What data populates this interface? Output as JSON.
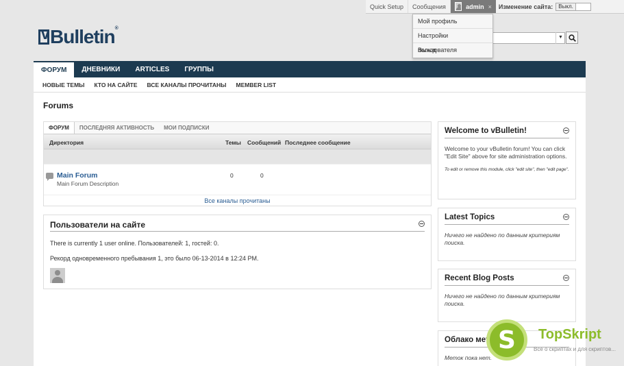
{
  "topbar": {
    "quick_setup": "Quick Setup",
    "messages": "Сообщения",
    "username": "admin",
    "close": "×",
    "edit_site_label": "Изменение сайта:",
    "toggle_value": "Выкл."
  },
  "user_menu": {
    "items": [
      "Мой профиль",
      "Настройки пользователя",
      "Выход"
    ]
  },
  "logo": {
    "text": "Bulletin",
    "tm": "®"
  },
  "search": {
    "dropdown_icon": "▼",
    "icon": "search-icon"
  },
  "nav": {
    "tabs": [
      "ФОРУМ",
      "ДНЕВНИКИ",
      "ARTICLES",
      "ГРУППЫ"
    ],
    "active_tab": 0,
    "subtabs": [
      "НОВЫЕ ТЕМЫ",
      "КТО НА САЙТЕ",
      "ВСЕ КАНАЛЫ ПРОЧИТАНЫ",
      "MEMBER LIST"
    ]
  },
  "page_title": "Forums",
  "forum_box": {
    "tabs": [
      "ФОРУМ",
      "ПОСЛЕДНЯЯ АКТИВНОСТЬ",
      "МОИ ПОДПИСКИ"
    ],
    "columns": [
      "Директория",
      "Темы",
      "Сообщений",
      "Последнее сообщение"
    ],
    "forum": {
      "name": "Main Forum",
      "description": "Main Forum Description",
      "threads": "0",
      "posts": "0"
    },
    "mark_read": "Все каналы прочитаны"
  },
  "online_box": {
    "title": "Пользователи на сайте",
    "line1": "There is currently 1 user online. Пользователей: 1, гостей: 0.",
    "line2": "Рекорд одновременного пребывания 1, это было 06-13-2014 в 12:24 PM."
  },
  "sidebar": {
    "welcome": {
      "title": "Welcome to vBulletin!",
      "body": "Welcome to your vBulletin forum! You can click \"Edit Site\" above for site administration options.",
      "note": "To edit or remove this module, click \"edit site\", then \"edit page\"."
    },
    "latest_topics": {
      "title": "Latest Topics",
      "body": "Ничего не найдено по данным критериям поиска."
    },
    "recent_blog": {
      "title": "Recent Blog Posts",
      "body": "Ничего не найдено по данным критериям поиска."
    },
    "tag_cloud": {
      "title": "Облако мет",
      "body": "Меток пока нет."
    }
  },
  "watermark": {
    "letter": "S",
    "name": "TopSkript",
    "tagline": "Все о скриптах и для скриптов..."
  }
}
